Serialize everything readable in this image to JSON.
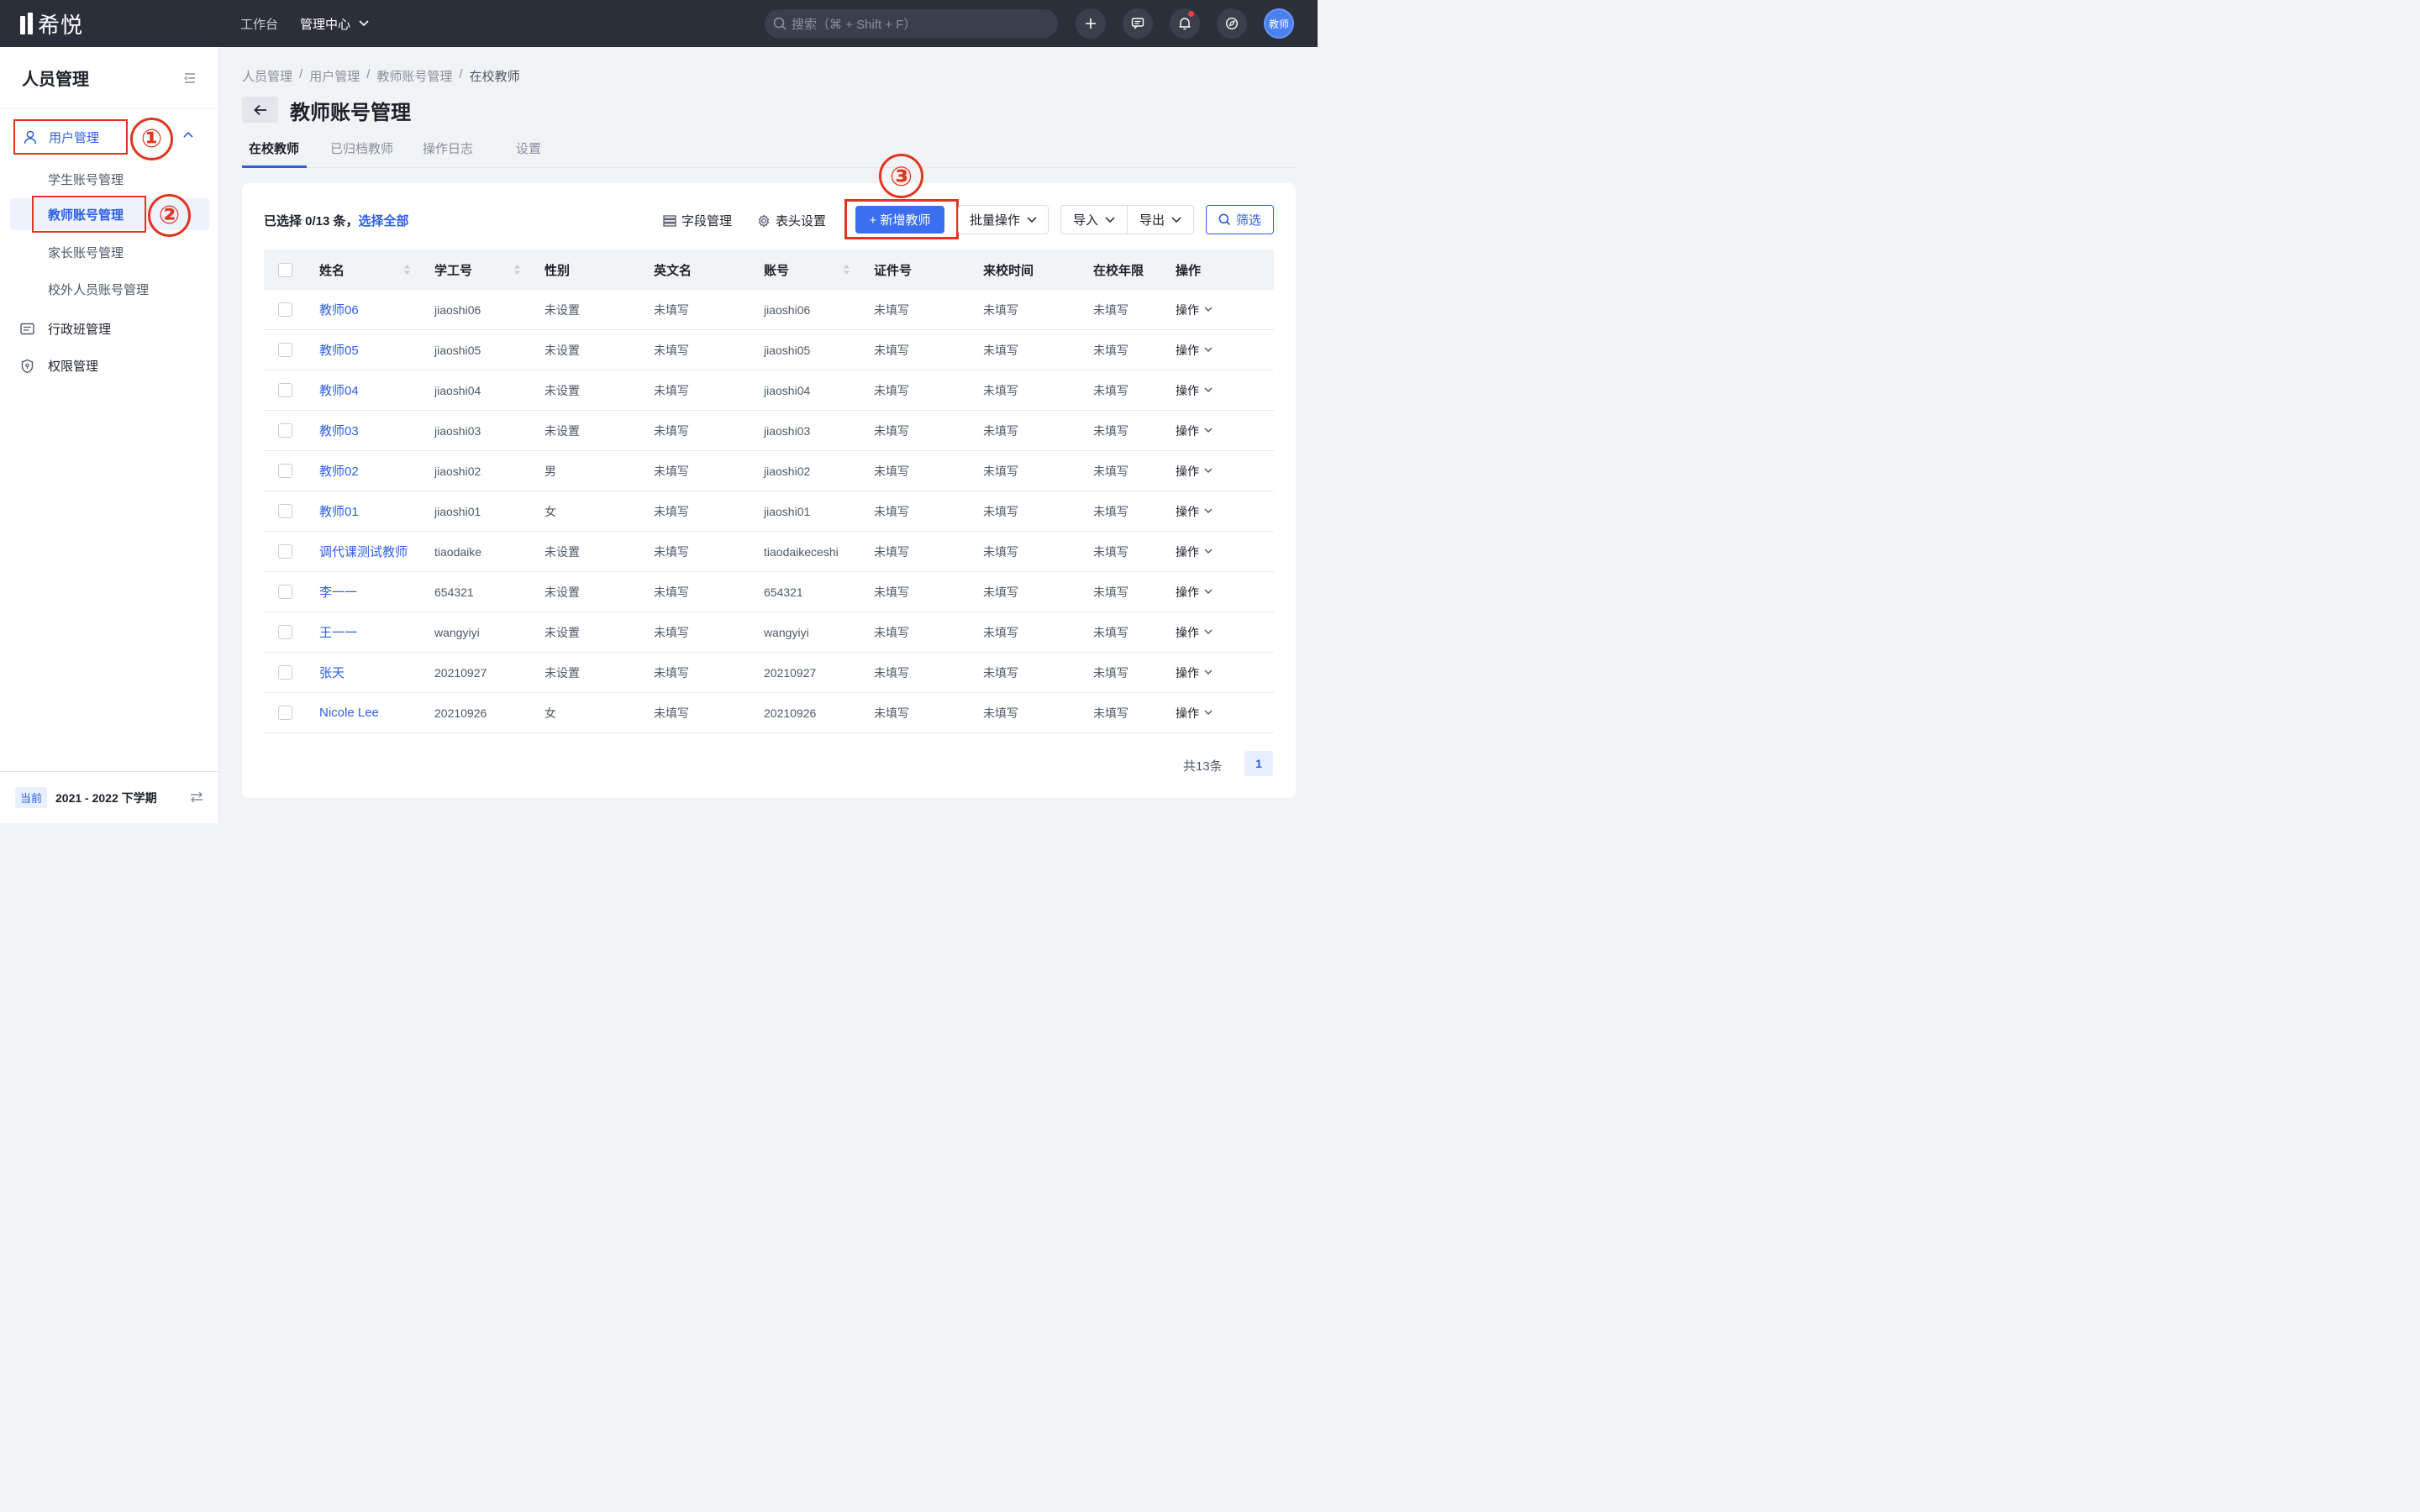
{
  "app": {
    "logo_text": "希悦"
  },
  "topbar": {
    "nav": [
      {
        "label": "工作台"
      },
      {
        "label": "管理中心"
      }
    ],
    "search_placeholder": "搜索（⌘ + Shift + F）",
    "avatar_label": "教师",
    "icons": [
      "plus-icon",
      "chat-icon",
      "bell-icon",
      "compass-icon"
    ]
  },
  "sidebar": {
    "title": "人员管理",
    "group_label": "用户管理",
    "sub_items": [
      {
        "label": "学生账号管理"
      },
      {
        "label": "教师账号管理"
      },
      {
        "label": "家长账号管理"
      },
      {
        "label": "校外人员账号管理"
      }
    ],
    "items": [
      {
        "label": "行政班管理"
      },
      {
        "label": "权限管理"
      }
    ],
    "footer": {
      "badge": "当前",
      "term": "2021 - 2022 下学期"
    }
  },
  "annotations": {
    "one": "①",
    "two": "②",
    "three": "③"
  },
  "breadcrumb": [
    "人员管理",
    "/",
    "用户管理",
    "/",
    "教师账号管理",
    "/",
    "在校教师"
  ],
  "page_title": "教师账号管理",
  "tabs": [
    {
      "label": "在校教师"
    },
    {
      "label": "已归档教师"
    },
    {
      "label": "操作日志"
    },
    {
      "label": "设置"
    }
  ],
  "toolbar": {
    "selected_prefix": "已选择 0/13 条，",
    "select_all": "选择全部",
    "field_mgmt": "字段管理",
    "header_settings": "表头设置",
    "add_teacher": "+ 新增教师",
    "batch": "批量操作",
    "import": "导入",
    "export": "导出",
    "filter": "筛选"
  },
  "table": {
    "headers": [
      "姓名",
      "学工号",
      "性别",
      "英文名",
      "账号",
      "证件号",
      "来校时间",
      "在校年限",
      "操作"
    ],
    "rows": [
      {
        "name": "教师06",
        "id": "jiaoshi06",
        "gender": "未设置",
        "en": "未填写",
        "account": "jiaoshi06",
        "cert": "未填写",
        "arrive": "未填写",
        "years": "未填写",
        "op": "操作"
      },
      {
        "name": "教师05",
        "id": "jiaoshi05",
        "gender": "未设置",
        "en": "未填写",
        "account": "jiaoshi05",
        "cert": "未填写",
        "arrive": "未填写",
        "years": "未填写",
        "op": "操作"
      },
      {
        "name": "教师04",
        "id": "jiaoshi04",
        "gender": "未设置",
        "en": "未填写",
        "account": "jiaoshi04",
        "cert": "未填写",
        "arrive": "未填写",
        "years": "未填写",
        "op": "操作"
      },
      {
        "name": "教师03",
        "id": "jiaoshi03",
        "gender": "未设置",
        "en": "未填写",
        "account": "jiaoshi03",
        "cert": "未填写",
        "arrive": "未填写",
        "years": "未填写",
        "op": "操作"
      },
      {
        "name": "教师02",
        "id": "jiaoshi02",
        "gender": "男",
        "en": "未填写",
        "account": "jiaoshi02",
        "cert": "未填写",
        "arrive": "未填写",
        "years": "未填写",
        "op": "操作"
      },
      {
        "name": "教师01",
        "id": "jiaoshi01",
        "gender": "女",
        "en": "未填写",
        "account": "jiaoshi01",
        "cert": "未填写",
        "arrive": "未填写",
        "years": "未填写",
        "op": "操作"
      },
      {
        "name": "调代课测试教师",
        "id": "tiaodaike",
        "gender": "未设置",
        "en": "未填写",
        "account": "tiaodaikeceshi",
        "cert": "未填写",
        "arrive": "未填写",
        "years": "未填写",
        "op": "操作"
      },
      {
        "name": "李一一",
        "id": "654321",
        "gender": "未设置",
        "en": "未填写",
        "account": "654321",
        "cert": "未填写",
        "arrive": "未填写",
        "years": "未填写",
        "op": "操作"
      },
      {
        "name": "王一一",
        "id": "wangyiyi",
        "gender": "未设置",
        "en": "未填写",
        "account": "wangyiyi",
        "cert": "未填写",
        "arrive": "未填写",
        "years": "未填写",
        "op": "操作"
      },
      {
        "name": "张天",
        "id": "20210927",
        "gender": "未设置",
        "en": "未填写",
        "account": "20210927",
        "cert": "未填写",
        "arrive": "未填写",
        "years": "未填写",
        "op": "操作"
      },
      {
        "name": "Nicole Lee",
        "id": "20210926",
        "gender": "女",
        "en": "未填写",
        "account": "20210926",
        "cert": "未填写",
        "arrive": "未填写",
        "years": "未填写",
        "op": "操作"
      }
    ]
  },
  "pagination": {
    "total": "共13条",
    "current": "1"
  },
  "colors": {
    "accent": "#2d5fe8",
    "annotation": "#e0351f",
    "topbar": "#2b2f3a"
  }
}
